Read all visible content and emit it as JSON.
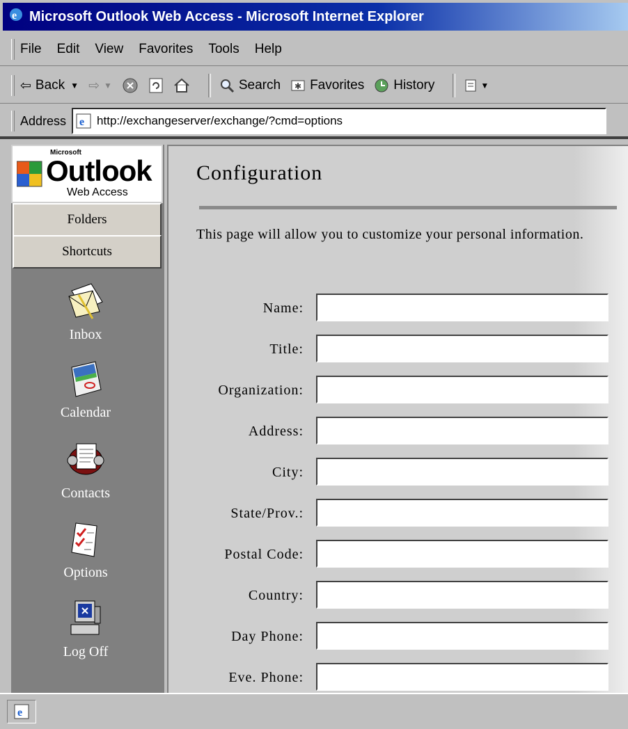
{
  "window": {
    "title": "Microsoft Outlook Web Access - Microsoft Internet Explorer"
  },
  "menu": {
    "items": [
      "File",
      "Edit",
      "View",
      "Favorites",
      "Tools",
      "Help"
    ]
  },
  "toolbar": {
    "back_label": "Back",
    "search_label": "Search",
    "favorites_label": "Favorites",
    "history_label": "History"
  },
  "address": {
    "label": "Address",
    "url": "http://exchangeserver/exchange/?cmd=options"
  },
  "logo": {
    "microsoft": "Microsoft",
    "outlook": "Outlook",
    "web_access": "Web Access"
  },
  "nav": {
    "folders_label": "Folders",
    "shortcuts_label": "Shortcuts"
  },
  "shortcuts": [
    {
      "label": "Inbox",
      "icon": "inbox-icon"
    },
    {
      "label": "Calendar",
      "icon": "calendar-icon"
    },
    {
      "label": "Contacts",
      "icon": "contacts-icon"
    },
    {
      "label": "Options",
      "icon": "options-icon"
    },
    {
      "label": "Log Off",
      "icon": "log-off-icon"
    }
  ],
  "main": {
    "title": "Configuration",
    "description": "This page will allow you to customize your personal information.",
    "fields": [
      {
        "label": "Name:",
        "value": ""
      },
      {
        "label": "Title:",
        "value": ""
      },
      {
        "label": "Organization:",
        "value": ""
      },
      {
        "label": "Address:",
        "value": ""
      },
      {
        "label": "City:",
        "value": ""
      },
      {
        "label": "State/Prov.:",
        "value": ""
      },
      {
        "label": "Postal Code:",
        "value": ""
      },
      {
        "label": "Country:",
        "value": ""
      },
      {
        "label": "Day Phone:",
        "value": ""
      },
      {
        "label": "Eve. Phone:",
        "value": ""
      }
    ]
  },
  "colors": {
    "title_bar": "#000080",
    "nav_pane": "#808080",
    "chrome": "#c0c0c0"
  }
}
